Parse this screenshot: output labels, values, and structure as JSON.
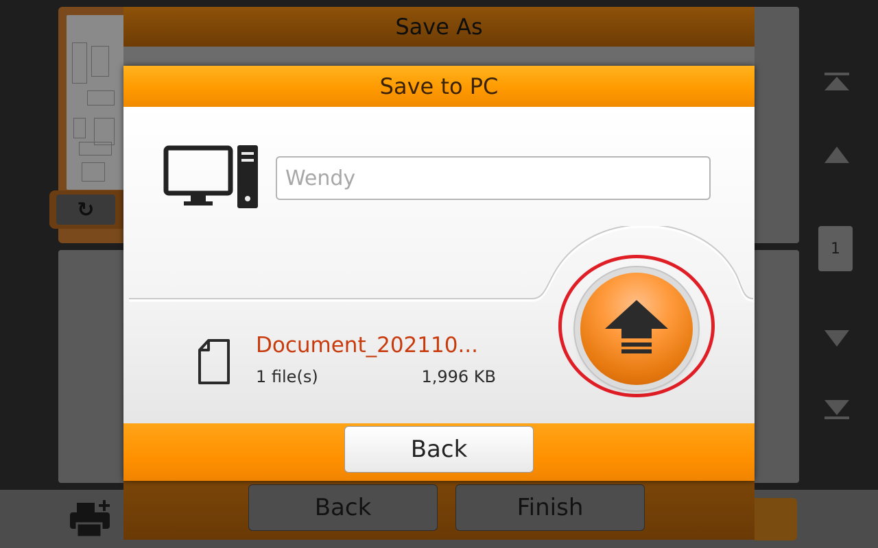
{
  "background_app": {
    "page_number": "1",
    "bottom_buttons": {
      "back_label": "Back",
      "finish_label": "Finish"
    },
    "icons": [
      "rotate-icon",
      "print-add-icon",
      "first-page-icon",
      "prev-page-icon",
      "next-page-icon",
      "last-page-icon"
    ]
  },
  "save_as": {
    "title": "Save As"
  },
  "save_to_pc": {
    "title": "Save to PC",
    "pc_name": {
      "placeholder": "Wendy",
      "value": ""
    },
    "file": {
      "name": "Document_202110...",
      "count": "1 file(s)",
      "size": "1,996 KB"
    },
    "back_label": "Back",
    "upload_icon": "upload-arrow-icon"
  },
  "colors": {
    "accent_orange": "#ff9a00",
    "file_name_red": "#c83a0c",
    "highlight_ring": "#e01e26",
    "dialog_body": "#ececec"
  }
}
